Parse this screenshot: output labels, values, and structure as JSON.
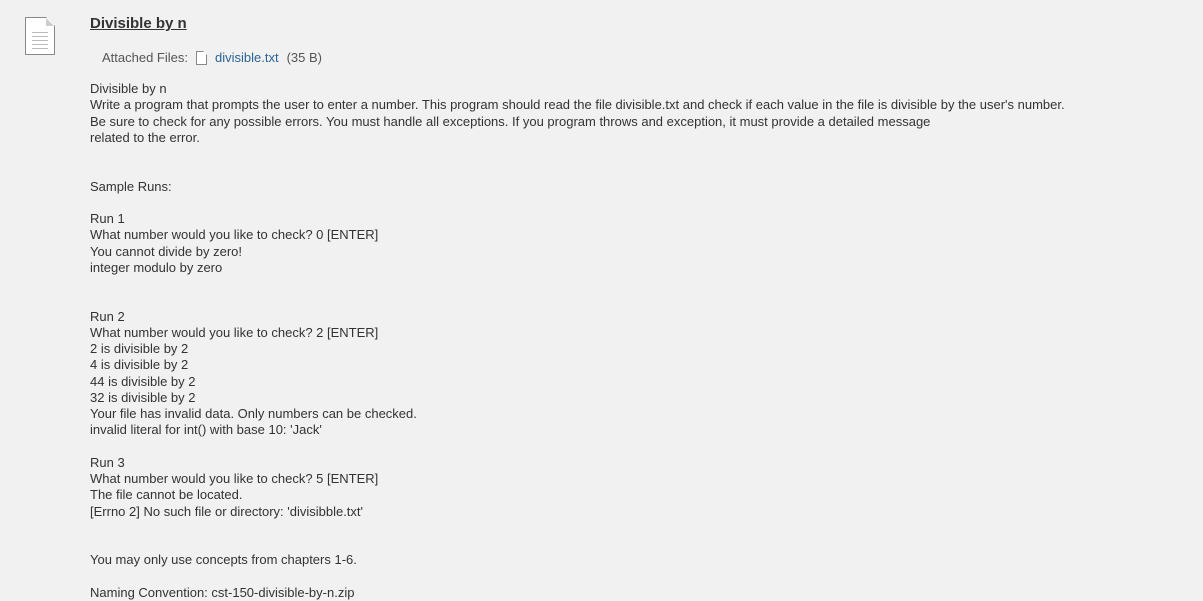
{
  "assignment": {
    "title": "Divisible by n",
    "attached_label": "Attached Files:",
    "file_name": "divisible.txt",
    "file_size": "(35 B)",
    "body": "Divisible by n\nWrite a program that prompts the user to enter a number.  This program should read the file divisible.txt and check if each value in the file is divisible by the user's number.\nBe sure to check for any possible errors. You must handle all exceptions. If you program throws and exception, it must provide a detailed message\nrelated to the error.\n\n\nSample Runs:\n\nRun 1\nWhat number would you like to check? 0 [ENTER]\nYou cannot divide by zero!\ninteger modulo by zero\n\n\nRun 2\nWhat number would you like to check? 2  [ENTER]\n2 is divisible by 2\n4 is divisible by 2\n44 is divisible by 2\n32 is divisible by 2\nYour file has invalid data.  Only numbers can be checked.\ninvalid literal for int() with base 10: 'Jack'\n\nRun 3\nWhat number would you like to check? 5  [ENTER]\nThe file cannot be located.\n[Errno 2] No such file or directory: 'divisibble.txt'\n\n\nYou may only use concepts from chapters 1-6.\n\nNaming Convention: cst-150-divisible-by-n.zip"
  }
}
